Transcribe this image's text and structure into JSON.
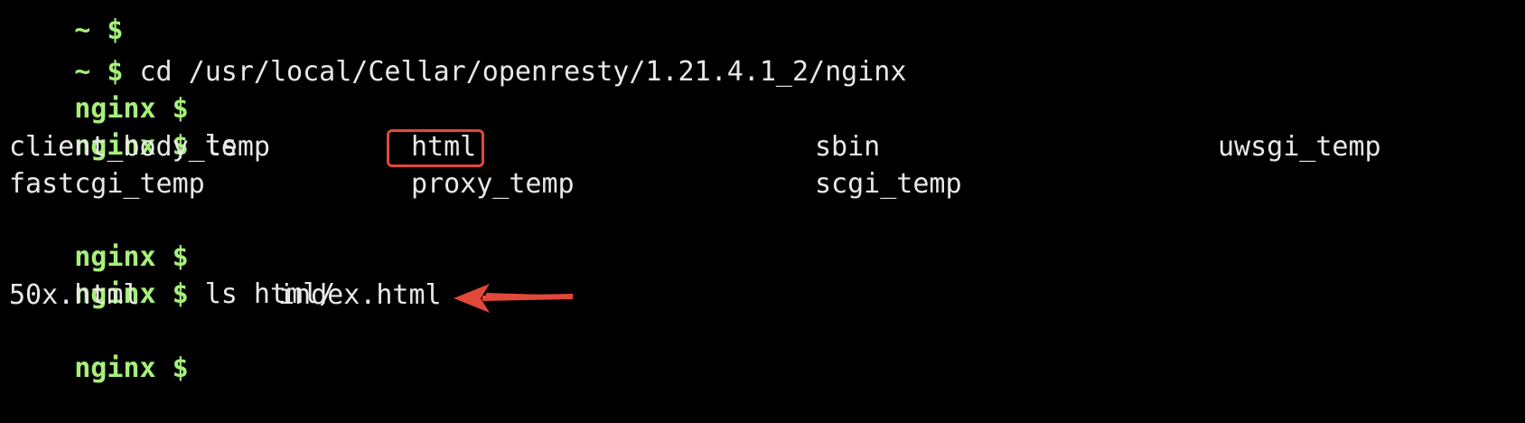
{
  "terminal": {
    "prompt_home": "~ $",
    "prompt_nginx": "nginx $",
    "line0": "~ $",
    "line1_cmd": " cd /usr/local/Cellar/openresty/1.21.4.1_2/nginx",
    "line3_cmd": " ls",
    "ls_output": [
      [
        "client_body_temp",
        "html",
        "sbin",
        "uwsgi_temp"
      ],
      [
        "fastcgi_temp",
        "proxy_temp",
        "scgi_temp",
        ""
      ]
    ],
    "line7_cmd": " ls html/",
    "html_files": [
      "50x.html",
      "index.html"
    ]
  },
  "annotations": {
    "highlight_color": "#e2483a",
    "prompt_color": "#a6f07a",
    "highlight_target": "html",
    "arrow_target": "index.html"
  }
}
